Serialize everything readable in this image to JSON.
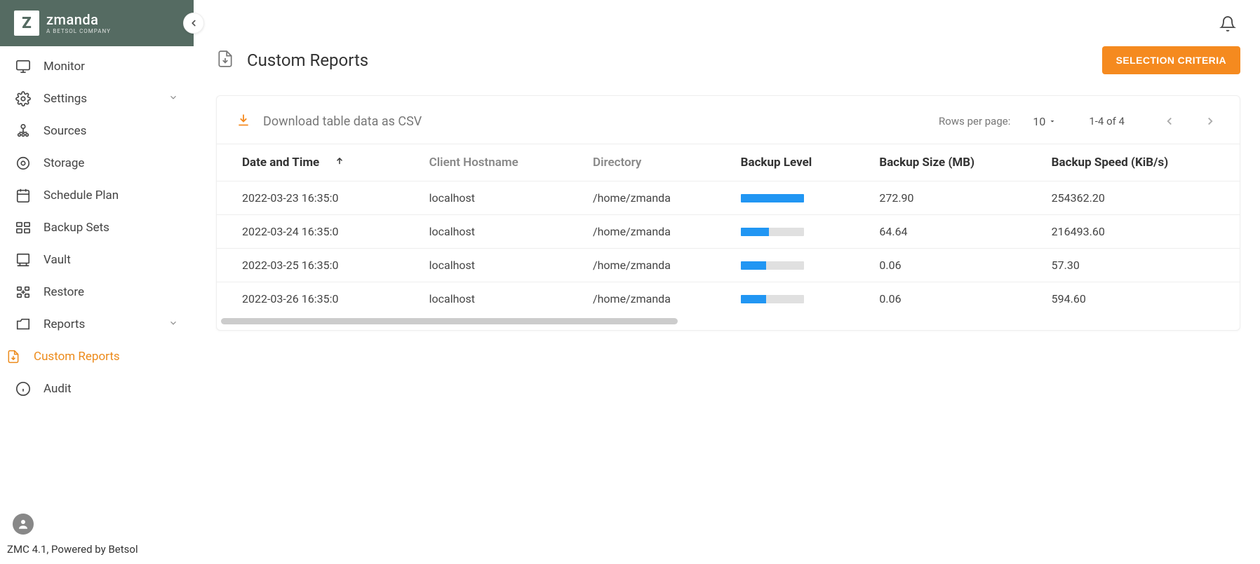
{
  "brand": {
    "name": "zmanda",
    "sub": "A BETSOL COMPANY"
  },
  "sidebar": {
    "items": [
      {
        "label": "Monitor"
      },
      {
        "label": "Settings",
        "expandable": true
      },
      {
        "label": "Sources"
      },
      {
        "label": "Storage"
      },
      {
        "label": "Schedule Plan"
      },
      {
        "label": "Backup Sets"
      },
      {
        "label": "Vault"
      },
      {
        "label": "Restore"
      },
      {
        "label": "Reports",
        "expandable": true
      },
      {
        "label": "Custom Reports",
        "active": true
      },
      {
        "label": "Audit"
      }
    ]
  },
  "footer": "ZMC 4.1, Powered by Betsol",
  "page": {
    "title": "Custom Reports",
    "primary_button": "SELECTION CRITERIA"
  },
  "toolbar": {
    "download_label": "Download table data as CSV",
    "rows_per_page_label": "Rows per page:",
    "rows_per_page_value": "10",
    "range_text": "1-4 of 4"
  },
  "table": {
    "headers": {
      "date": "Date and Time",
      "host": "Client Hostname",
      "dir": "Directory",
      "level": "Backup Level",
      "size": "Backup Size (MB)",
      "speed": "Backup Speed (KiB/s)"
    },
    "rows": [
      {
        "date": "2022-03-23 16:35:0",
        "host": "localhost",
        "dir": "/home/zmanda",
        "level_pct": 100,
        "size": "272.90",
        "speed": "254362.20"
      },
      {
        "date": "2022-03-24 16:35:0",
        "host": "localhost",
        "dir": "/home/zmanda",
        "level_pct": 45,
        "size": "64.64",
        "speed": "216493.60"
      },
      {
        "date": "2022-03-25 16:35:0",
        "host": "localhost",
        "dir": "/home/zmanda",
        "level_pct": 40,
        "size": "0.06",
        "speed": "57.30"
      },
      {
        "date": "2022-03-26 16:35:0",
        "host": "localhost",
        "dir": "/home/zmanda",
        "level_pct": 40,
        "size": "0.06",
        "speed": "594.60"
      }
    ]
  }
}
